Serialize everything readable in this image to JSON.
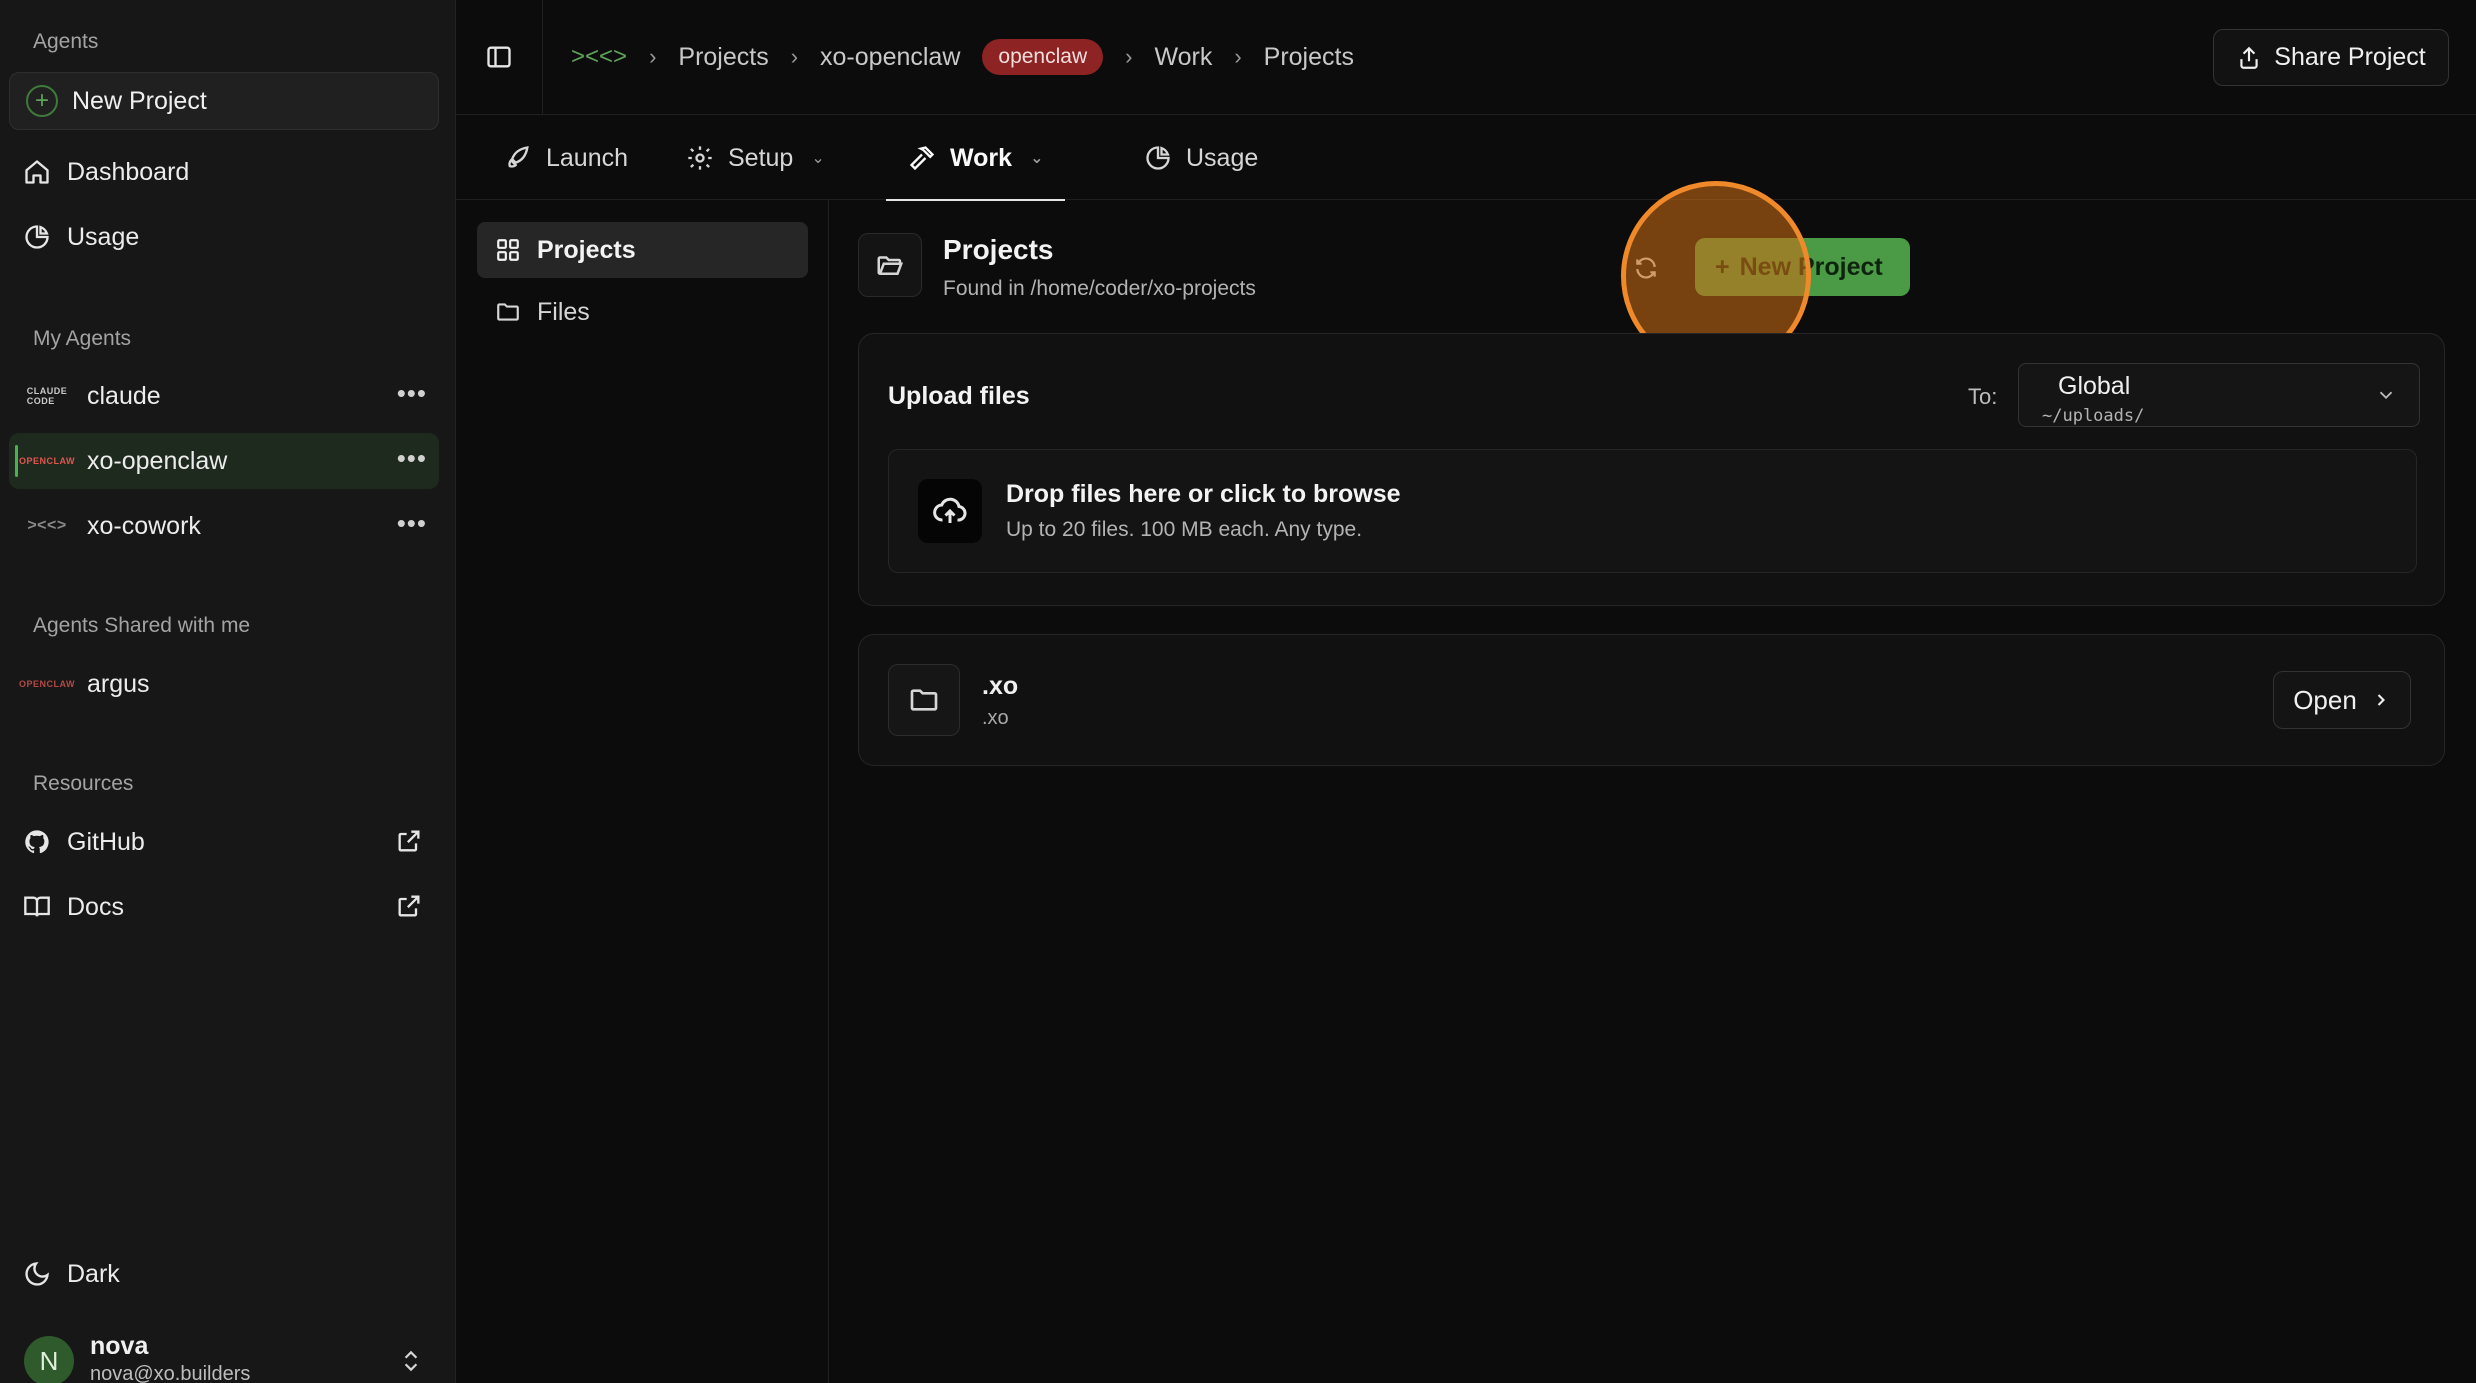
{
  "sidebar": {
    "agents_title": "Agents",
    "new_project": "New Project",
    "nav": [
      {
        "label": "Dashboard",
        "icon": "home-icon"
      },
      {
        "label": "Usage",
        "icon": "pie-chart-icon"
      }
    ],
    "my_agents_title": "My Agents",
    "my_agents": [
      {
        "label": "claude",
        "logo": "CLAUDE CODE"
      },
      {
        "label": "xo-openclaw",
        "logo": "OPENCLAW",
        "active": true
      },
      {
        "label": "xo-cowork",
        "logo": "xo-logo"
      }
    ],
    "shared_title": "Agents Shared with me",
    "shared_agents": [
      {
        "label": "argus",
        "logo": "OPENCLAW"
      }
    ],
    "resources_title": "Resources",
    "resources": [
      {
        "label": "GitHub",
        "icon": "github-icon"
      },
      {
        "label": "Docs",
        "icon": "book-icon"
      }
    ],
    "theme": "Dark",
    "user": {
      "initial": "N",
      "name": "nova",
      "email": "nova@xo.builders"
    }
  },
  "header": {
    "breadcrumbs": [
      "Projects",
      "xo-openclaw",
      "Work",
      "Projects"
    ],
    "badge": "openclaw",
    "share_label": "Share Project"
  },
  "tabs": [
    {
      "label": "Launch",
      "icon": "rocket-icon"
    },
    {
      "label": "Setup",
      "icon": "gear-icon",
      "dropdown": true
    },
    {
      "label": "Work",
      "icon": "hammer-icon",
      "dropdown": true,
      "active": true
    },
    {
      "label": "Usage",
      "icon": "pie-chart-icon"
    }
  ],
  "subnav": [
    {
      "label": "Projects",
      "icon": "grid-icon",
      "active": true
    },
    {
      "label": "Files",
      "icon": "folder-icon"
    }
  ],
  "page": {
    "title": "Projects",
    "subtitle": "Found in /home/coder/xo-projects",
    "new_project_label": "New Project"
  },
  "upload": {
    "title": "Upload files",
    "to_label": "To:",
    "destination": "Global",
    "destination_path": "~/uploads/",
    "drop_title": "Drop files here or click to browse",
    "drop_sub": "Up to 20 files. 100 MB each. Any type."
  },
  "projects": [
    {
      "name": ".xo",
      "path": ".xo",
      "open_label": "Open"
    }
  ],
  "colors": {
    "accent": "#4a9a46",
    "badge": "#8e2323",
    "highlight": "#f0892a"
  }
}
